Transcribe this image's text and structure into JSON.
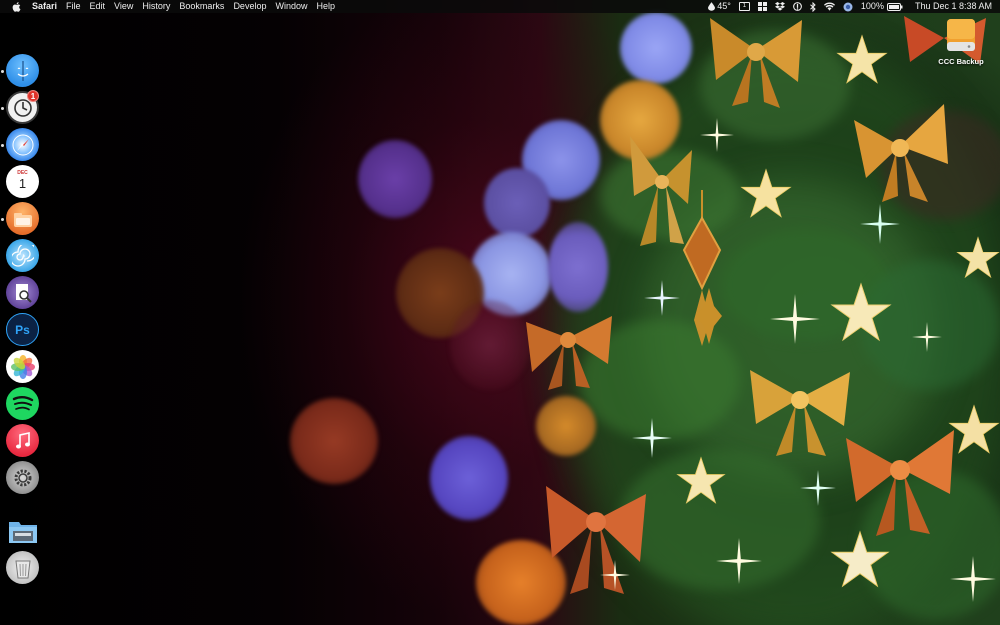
{
  "menubar": {
    "apple_icon": "apple-logo-icon",
    "app_name": "Safari",
    "menus": [
      "File",
      "Edit",
      "View",
      "History",
      "Bookmarks",
      "Develop",
      "Window",
      "Help"
    ],
    "temperature": "45°",
    "calendar_day": "1",
    "battery_percent": "100%",
    "datetime": "Thu Dec 1  8:38 AM"
  },
  "dock": {
    "items": [
      {
        "name": "finder-icon",
        "color": "#2f8fe8"
      },
      {
        "name": "mail-icon",
        "color": "#f1f1f1",
        "badge": "1"
      },
      {
        "name": "safari-icon",
        "color": "#3a8ff0"
      },
      {
        "name": "calendar-icon",
        "color": "#ffffff",
        "month": "DEC",
        "day": "1"
      },
      {
        "name": "files-icon",
        "color": "#f08a3e"
      },
      {
        "name": "shell-app-icon",
        "color": "#39a6e8"
      },
      {
        "name": "preview-icon",
        "color": "#6b4ea0"
      },
      {
        "name": "photoshop-icon",
        "color": "#0b2244",
        "label": "Ps"
      },
      {
        "name": "photos-icon",
        "color": "#ffffff"
      },
      {
        "name": "spotify-icon",
        "color": "#1ed760"
      },
      {
        "name": "music-icon",
        "color": "#f5394e"
      },
      {
        "name": "system-preferences-icon",
        "color": "#9a9a9a"
      },
      {
        "name": "downloads-folder-icon",
        "color": "#6fb3e8"
      },
      {
        "name": "trash-icon",
        "color": "#dcdcdc"
      }
    ]
  },
  "desktop": {
    "drive_label": "CCC Backup",
    "drive_color": "#f0a030"
  }
}
